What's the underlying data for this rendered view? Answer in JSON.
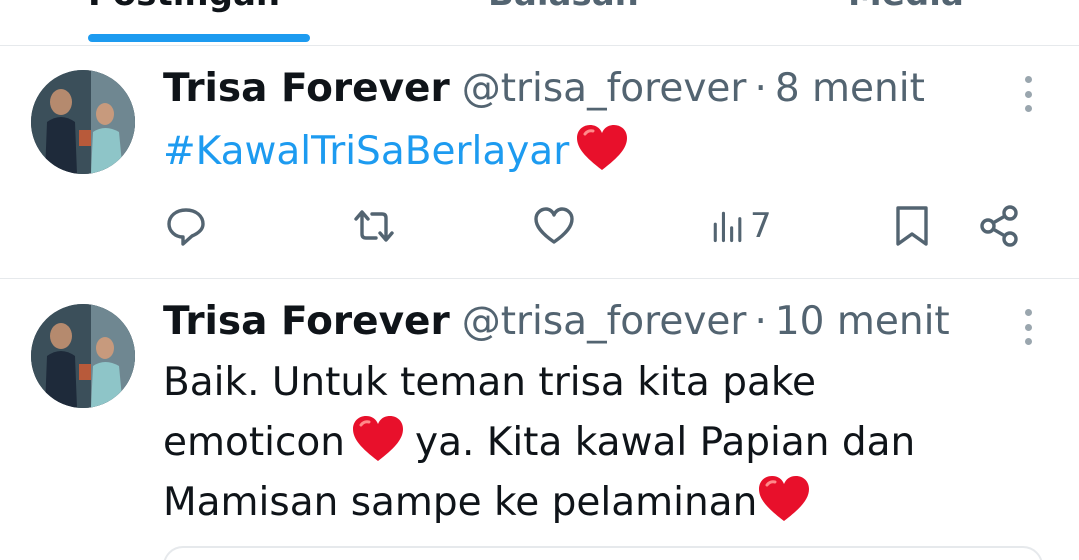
{
  "tabs": [
    {
      "label": "Postingan",
      "active": true
    },
    {
      "label": "Balasan",
      "active": false
    },
    {
      "label": "Media",
      "active": false
    }
  ],
  "colors": {
    "accent": "#1d9bf0",
    "muted": "#536471",
    "text": "#0f1419",
    "heart": "#e8102b"
  },
  "tweets": [
    {
      "name": "Trisa Forever",
      "handle": "@trisa_forever",
      "separator": "·",
      "time": "8 menit",
      "hashtag": "#KawalTriSaBerlayar",
      "views": "7",
      "icons": [
        "reply-icon",
        "retweet-icon",
        "like-icon",
        "views-icon",
        "bookmark-icon",
        "share-icon"
      ]
    },
    {
      "name": "Trisa Forever",
      "handle": "@trisa_forever",
      "separator": "·",
      "time": "10 menit",
      "line1": "Baik. Untuk teman trisa kita pake",
      "line2a": "emoticon",
      "line2b": "ya. Kita kawal Papian dan",
      "line3": "Mamisan sampe ke pelaminan"
    }
  ]
}
